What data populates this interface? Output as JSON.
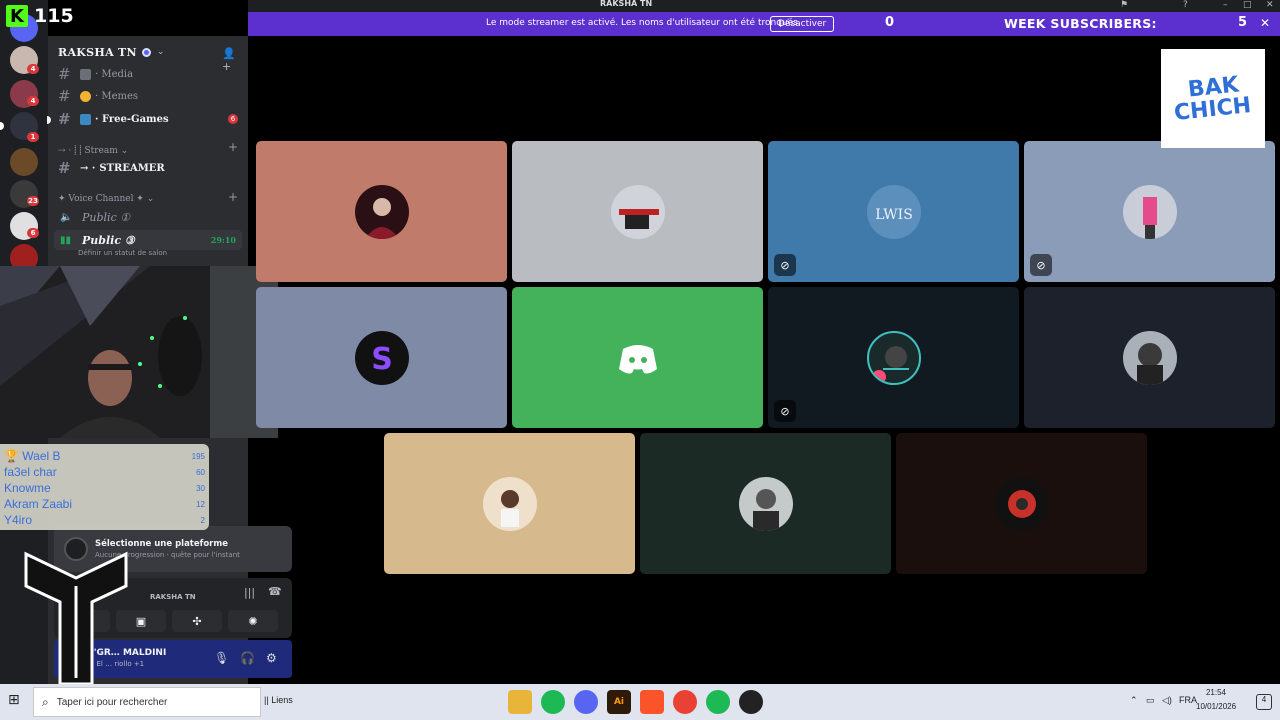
{
  "kick": {
    "count": "115"
  },
  "titlebar": {
    "title": "RAKSHA TN"
  },
  "banner": {
    "text": "Le mode streamer est activé. Les noms d'utilisateur ont été tronqués.",
    "button": "Désactiver",
    "subs_zero": "0",
    "subs_label": "WEEK SUBSCRIBERS:",
    "subs_value": "5"
  },
  "rail": {
    "badges": [
      "4",
      "4",
      "1",
      "1",
      "23",
      "6",
      "435"
    ]
  },
  "server": {
    "name": "RAKSHA TN"
  },
  "channels": [
    {
      "name": "Media",
      "prefix": "·"
    },
    {
      "name": "Memes",
      "prefix": "·"
    },
    {
      "name": "Free-Games",
      "prefix": "·",
      "badge": "6"
    }
  ],
  "categories": {
    "stream": "⇢ · ⸽ ⸽ Stream ⌄",
    "voice": "✦ Voice Channel ✦ ⌄"
  },
  "streamer_channel": "STREAMER",
  "voice_channels": [
    {
      "name": "Public",
      "count": "①"
    },
    {
      "name": "Public",
      "count": "③",
      "time": "29:10",
      "status": "Définir un statut de salon"
    }
  ],
  "leaderboard": [
    {
      "name": "Wael B",
      "value": "195"
    },
    {
      "name": "fa3el char",
      "value": "60"
    },
    {
      "name": "Knowme",
      "value": "30"
    },
    {
      "name": "Akram Zaabi",
      "value": "12"
    },
    {
      "name": "Y4iro",
      "value": "2"
    }
  ],
  "quest": {
    "title": "Sélectionne une plateforme",
    "subtitle": "Aucune progression · quête pour l'instant"
  },
  "voice_connected": {
    "server": "RAKSHA TN"
  },
  "user": {
    "name": "L'GR… MALDINI",
    "status": "♫ El … riollo +1"
  },
  "stage_colors": {
    "row1": [
      "#c07b6a",
      "#b9bcc0",
      "#3f7aab",
      "#8b9cb8"
    ],
    "row2": [
      "#7f8ba6",
      "#43b25a",
      "#111a21",
      "#1c212b"
    ],
    "row3": [
      "#d6b98d",
      "#1b2a24",
      "#1a0f0d"
    ]
  },
  "brand": {
    "line1": "BAK",
    "line2": "CHICH"
  },
  "taskbar": {
    "search_placeholder": "Taper ici pour rechercher",
    "links": "Liens",
    "lang": "FRA",
    "time": "21:54",
    "date": "10/01/2026",
    "notif": "4"
  }
}
